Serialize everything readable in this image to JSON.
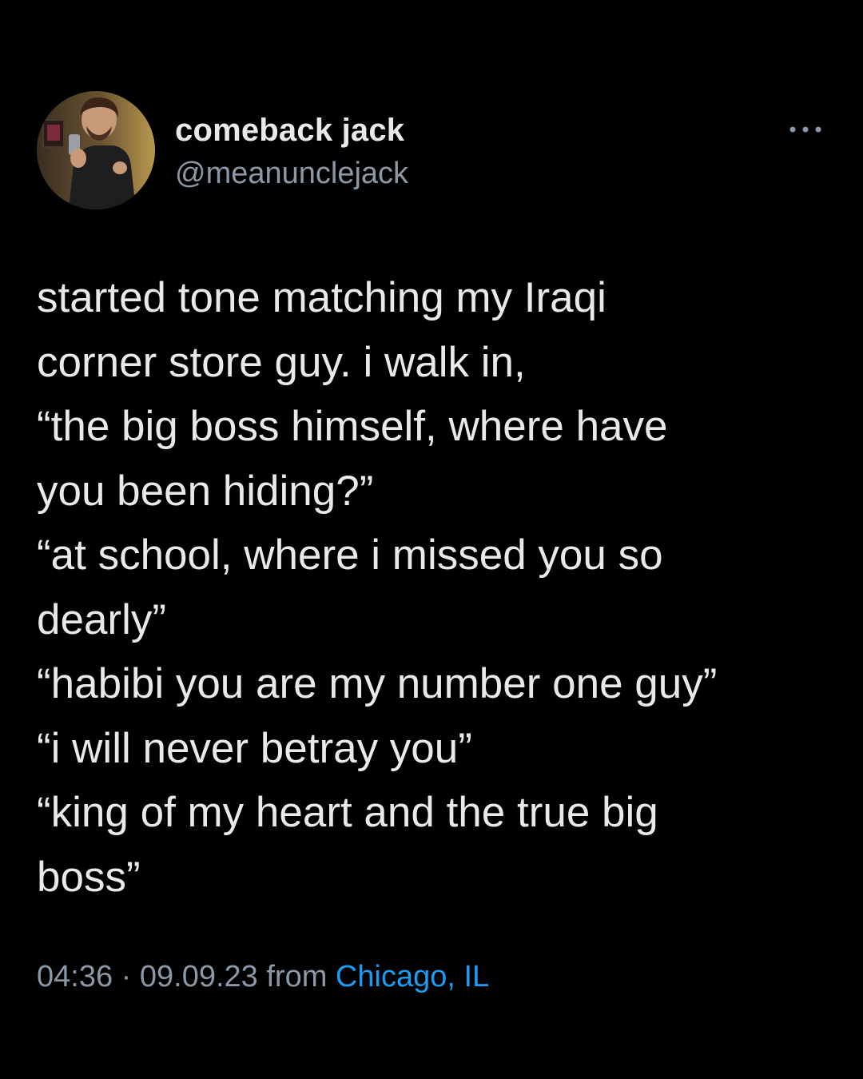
{
  "author": {
    "display_name": "comeback jack",
    "handle": "@meanunclejack",
    "avatar": "avatar-photo"
  },
  "menu": {
    "icon": "more-horizontal-icon"
  },
  "tweet": {
    "lines": [
      "started tone matching my Iraqi",
      "corner store guy. i walk in,",
      "“the big boss himself, where have",
      "you been hiding?”",
      "“at school, where i missed you so",
      "dearly”",
      "“habibi you are my number one guy”",
      "“i will never betray you”",
      "“king of my heart and the true big",
      "boss”"
    ],
    "time": "04:36",
    "separator": " · ",
    "date": "09.09.23",
    "from_label": " from ",
    "location": "Chicago, IL"
  },
  "colors": {
    "background": "#000000",
    "text": "#e7e9ea",
    "secondary": "#8b98a5",
    "accent": "#1d9bf0"
  }
}
